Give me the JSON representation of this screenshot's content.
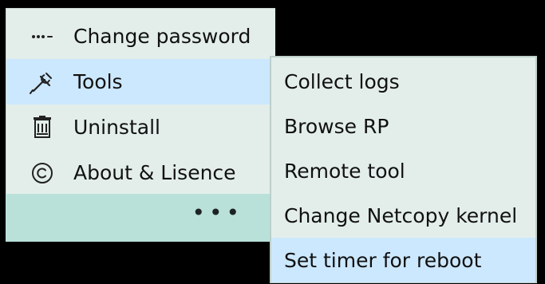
{
  "main_menu": {
    "items": [
      {
        "label": "Change password",
        "icon": "password-icon"
      },
      {
        "label": "Tools",
        "icon": "tools-icon"
      },
      {
        "label": "Uninstall",
        "icon": "trash-icon"
      },
      {
        "label": "About & Lisence",
        "icon": "copyright-icon"
      }
    ]
  },
  "footer": {
    "more_label": "•••"
  },
  "submenu": {
    "items": [
      {
        "label": "Collect logs"
      },
      {
        "label": "Browse RP"
      },
      {
        "label": "Remote tool"
      },
      {
        "label": "Change Netcopy kernel"
      },
      {
        "label": "Set timer for reboot"
      }
    ]
  },
  "colors": {
    "menu_background": "#E3EEEB",
    "highlight": "#CCE8FF",
    "footer_strip": "#B9E1DA",
    "page_background": "#000000"
  }
}
